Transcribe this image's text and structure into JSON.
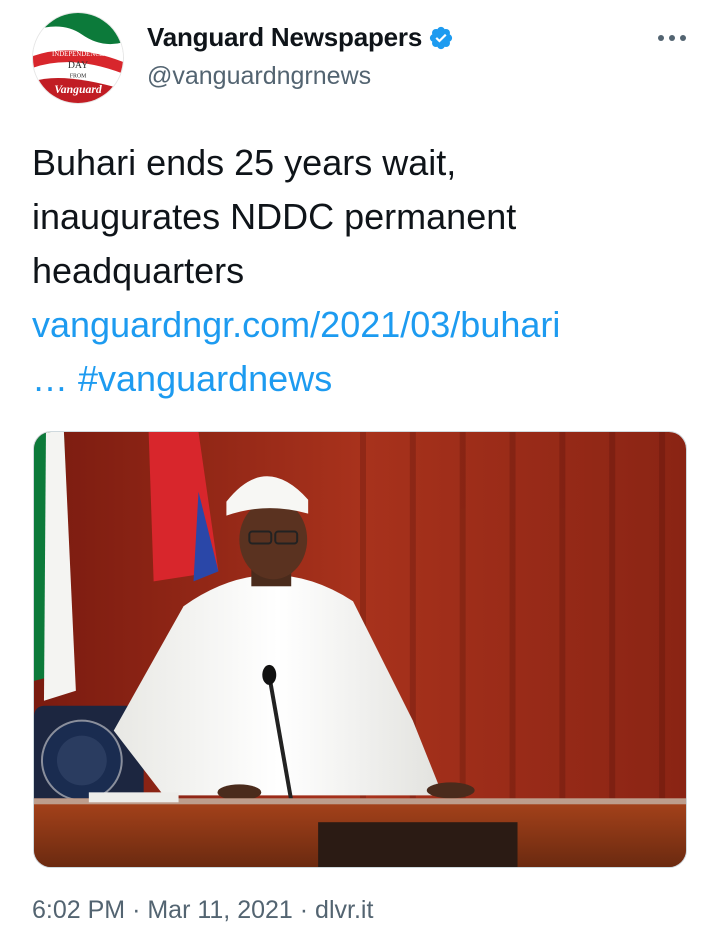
{
  "author": {
    "display_name": "Vanguard Newspapers",
    "handle": "@vanguardngrnews",
    "verified": true,
    "avatar_text": {
      "line1": "HAPPY",
      "line2": "INDEPENDENCE",
      "line3": "DAY",
      "line4": "FROM",
      "brand": "Vanguard"
    }
  },
  "icons": {
    "verified": "verified-badge-icon",
    "more": "more-options-icon"
  },
  "tweet": {
    "text_line1": "Buhari ends 25 years wait,",
    "text_line2": "inaugurates NDDC permanent",
    "text_line3": "headquarters",
    "link_line1": "vanguardngr.com/2021/03/buhari",
    "link_ellipsis": "…",
    "hashtag": "#vanguardnews"
  },
  "meta": {
    "time": "6:02 PM",
    "separator": "·",
    "date": "Mar 11, 2021",
    "source": "dlvr.it"
  },
  "colors": {
    "link": "#1d9bf0",
    "verified": "#1d9bf0",
    "secondary_text": "#536471",
    "primary_text": "#0f1419"
  }
}
